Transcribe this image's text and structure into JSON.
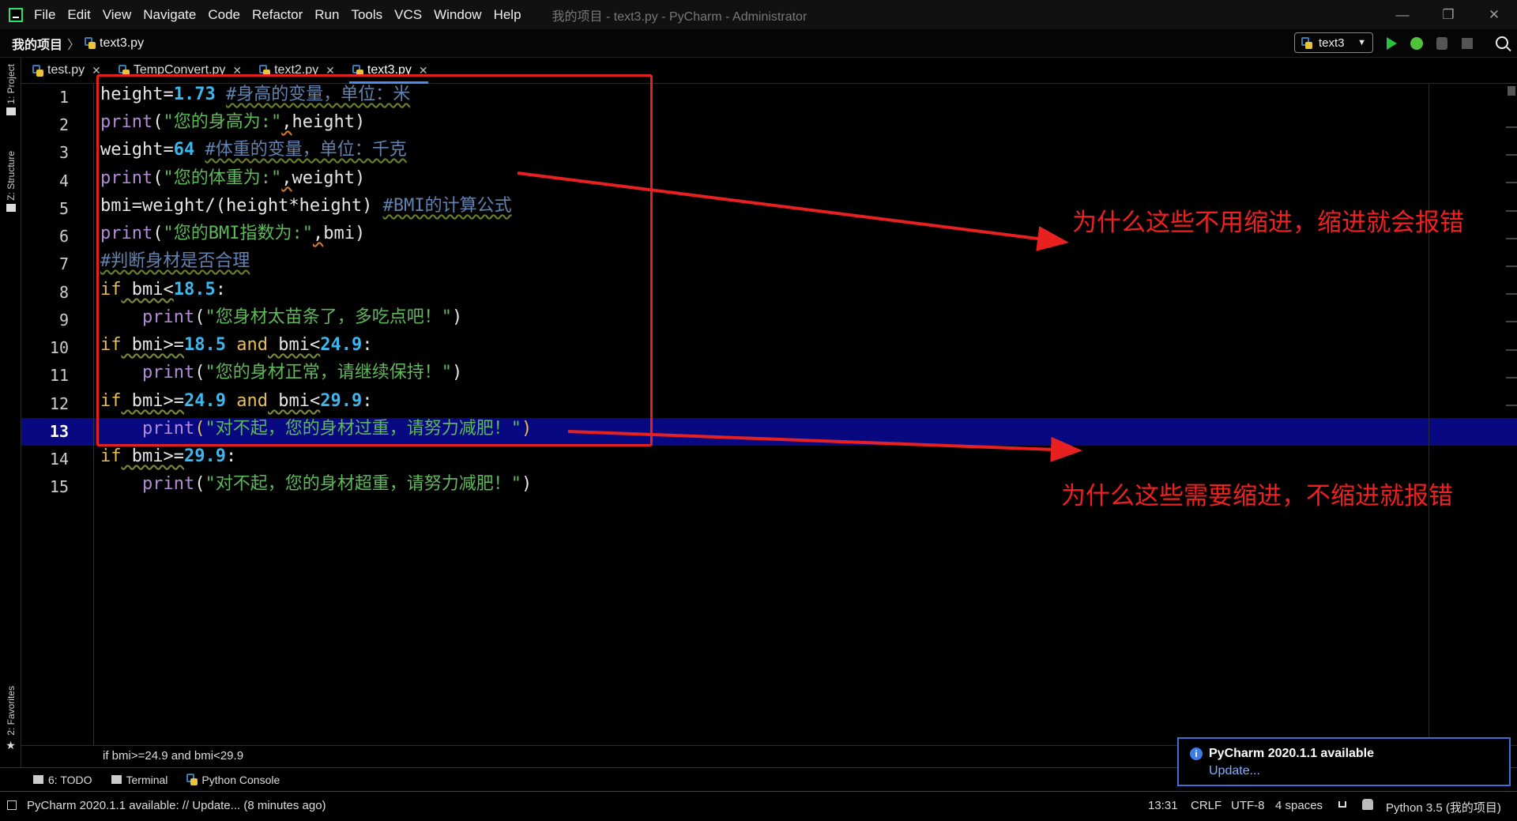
{
  "titlebar": {
    "menu": [
      "File",
      "Edit",
      "View",
      "Navigate",
      "Code",
      "Refactor",
      "Run",
      "Tools",
      "VCS",
      "Window",
      "Help"
    ],
    "window_title": "我的项目 - text3.py - PyCharm - Administrator",
    "minimize": "—",
    "restore": "❐",
    "close": "✕"
  },
  "navbar": {
    "project": "我的项目",
    "separator": "〉",
    "file": "text3.py",
    "run_config": "text3"
  },
  "left_strip": {
    "project": "1: Project",
    "structure": "Z: Structure",
    "favorites": "2: Favorites"
  },
  "tabs": [
    {
      "label": "test.py",
      "active": false
    },
    {
      "label": "TempConvert.py",
      "active": false
    },
    {
      "label": "text2.py",
      "active": false
    },
    {
      "label": "text3.py",
      "active": true
    }
  ],
  "tab_close": "✕",
  "editor": {
    "line_numbers": [
      "1",
      "2",
      "3",
      "4",
      "5",
      "6",
      "7",
      "8",
      "9",
      "10",
      "11",
      "12",
      "13",
      "14",
      "15"
    ],
    "current_line": "13",
    "code": {
      "l1": {
        "a": "height",
        "b": "=",
        "c": "1.73",
        "d": " ",
        "e": "#身高的变量，单位：米"
      },
      "l2": {
        "a": "print",
        "b": "(",
        "c": "\"您的身高为:\"",
        "d": ",",
        "e": "height",
        "f": ")"
      },
      "l3": {
        "a": "weight",
        "b": "=",
        "c": "64",
        "d": " ",
        "e": "#体重的变量，单位：千克"
      },
      "l4": {
        "a": "print",
        "b": "(",
        "c": "\"您的体重为:\"",
        "d": ",",
        "e": "weight",
        "f": ")"
      },
      "l5": {
        "a": "bmi=weight/(height*height)",
        "b": " ",
        "c": "#BMI的计算公式"
      },
      "l6": {
        "a": "print",
        "b": "(",
        "c": "\"您的BMI指数为:\"",
        "d": ",",
        "e": "bmi",
        "f": ")"
      },
      "l7": {
        "a": "#判断身材是否合理"
      },
      "l8": {
        "a": "if",
        "b": " bmi<",
        "c": "18.5",
        "d": ":"
      },
      "l9": {
        "indent": "    ",
        "a": "print",
        "b": "(",
        "c": "\"您身材太苗条了，多吃点吧！\"",
        "d": ")"
      },
      "l10": {
        "a": "if",
        "b": " bmi>=",
        "c": "18.5",
        "d": " ",
        "e": "and",
        "f": " bmi<",
        "g": "24.9",
        "h": ":"
      },
      "l11": {
        "indent": "    ",
        "a": "print",
        "b": "(",
        "c": "\"您的身材正常，请继续保持！\"",
        "d": ")"
      },
      "l12": {
        "a": "if",
        "b": " bmi>=",
        "c": "24.9",
        "d": " ",
        "e": "and",
        "f": " bmi<",
        "g": "29.9",
        "h": ":"
      },
      "l13": {
        "indent": "    ",
        "a": "print",
        "b": "(",
        "c": "\"对不起，您的身材过重，请努力减肥！\"",
        "d": ")"
      },
      "l14": {
        "a": "if",
        "b": " bmi>=",
        "c": "29.9",
        "d": ":"
      },
      "l15": {
        "indent": "    ",
        "a": "print",
        "b": "(",
        "c": "\"对不起，您的身材超重，请努力减肥！\"",
        "d": ")"
      }
    }
  },
  "annotations": {
    "top_note": "为什么这些不用缩进，缩进就会报错",
    "bottom_note": "为什么这些需要缩进，不缩进就报错",
    "color": "#f02020"
  },
  "structure_bar": "if bmi>=24.9 and bmi<29.9",
  "bottom_tabs": {
    "todo": "6: TODO",
    "terminal": "Terminal",
    "python_console": "Python Console"
  },
  "status": {
    "message": "PyCharm 2020.1.1 available: // Update... (8 minutes ago)",
    "position": "13:31",
    "line_sep": "CRLF",
    "encoding": "UTF-8",
    "indent": "4 spaces",
    "interpreter": "Python 3.5 (我的项目)"
  },
  "notification": {
    "title": "PyCharm 2020.1.1 available",
    "link": "Update..."
  },
  "colors": {
    "current_line": "#080880",
    "keyword": "#e8bf57",
    "number": "#3cb8f0",
    "string": "#5fb85a",
    "builtin": "#b28cd8",
    "comment": "#5c7ba0",
    "accent": "#3b6fd0"
  }
}
